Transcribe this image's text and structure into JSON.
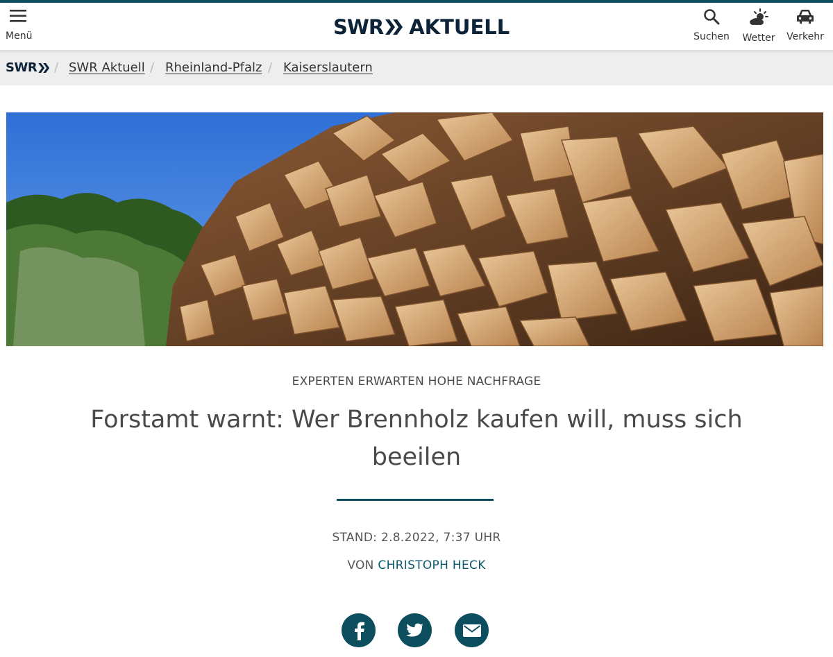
{
  "header": {
    "menu_label": "Menü",
    "logo_left": "SWR",
    "logo_right": "AKTUELL",
    "search_label": "Suchen",
    "weather_label": "Wetter",
    "traffic_label": "Verkehr",
    "accent_color": "#0c4e5e",
    "icons": [
      "hamburger-icon",
      "search-icon",
      "weather-icon",
      "car-icon"
    ]
  },
  "breadcrumb": {
    "logo": "SWR",
    "separator": "/",
    "items": [
      {
        "label": "SWR Aktuell"
      },
      {
        "label": "Rheinland-Pfalz"
      },
      {
        "label": "Kaiserslautern"
      }
    ]
  },
  "article": {
    "kicker": "EXPERTEN ERWARTEN HOHE NACHFRAGE",
    "title": "Forstamt warnt: Wer Brennholz kaufen will, muss sich beeilen",
    "stand": "STAND: 2.8.2022, 7:37 UHR",
    "author_prefix": "VON",
    "author_name": "CHRISTOPH HECK"
  },
  "share": {
    "icons": [
      "facebook-icon",
      "twitter-icon",
      "mail-icon"
    ]
  }
}
